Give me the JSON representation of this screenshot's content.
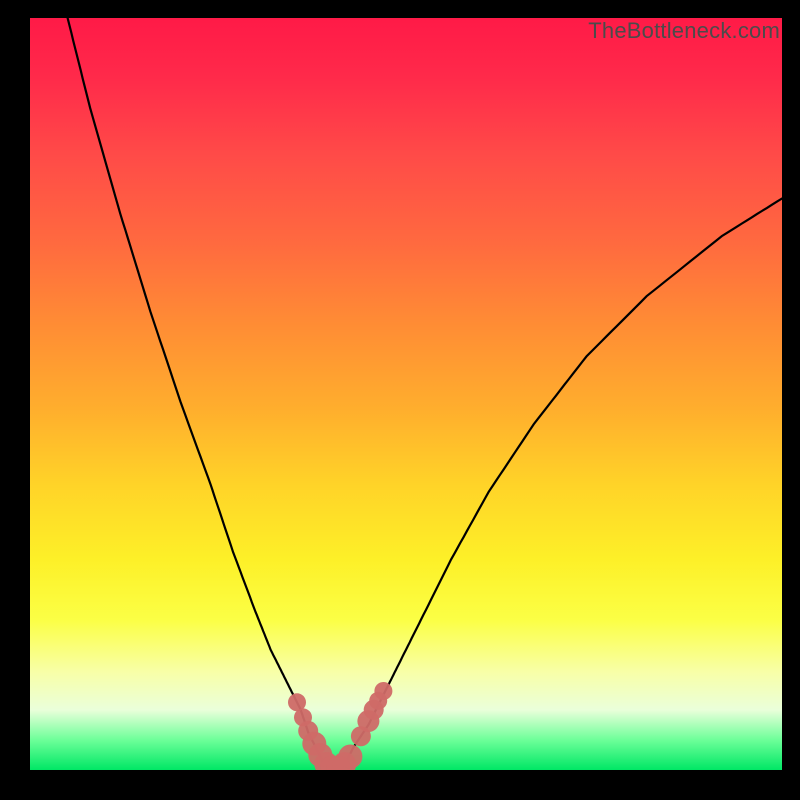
{
  "watermark": "TheBottleneck.com",
  "colors": {
    "background": "#000000",
    "gradient_top": "#ff1a47",
    "gradient_bottom": "#00e765",
    "curve_stroke": "#000000",
    "marker_fill": "#cf6a67"
  },
  "chart_data": {
    "type": "line",
    "title": "",
    "xlabel": "",
    "ylabel": "",
    "xlim": [
      0,
      100
    ],
    "ylim": [
      0,
      100
    ],
    "grid": false,
    "series": [
      {
        "name": "bottleneck_curve",
        "x": [
          5,
          8,
          12,
          16,
          20,
          24,
          27,
          30,
          32,
          34,
          36,
          37,
          38,
          39,
          40,
          41,
          42,
          43,
          45,
          47,
          49,
          52,
          56,
          61,
          67,
          74,
          82,
          92,
          100
        ],
        "values": [
          100,
          88,
          74,
          61,
          49,
          38,
          29,
          21,
          16,
          12,
          8,
          5,
          3,
          1,
          0,
          0,
          1,
          3,
          6,
          10,
          14,
          20,
          28,
          37,
          46,
          55,
          63,
          71,
          76
        ]
      }
    ],
    "markers": {
      "name": "highlight_points",
      "x": [
        35.5,
        36.3,
        37.0,
        37.8,
        38.6,
        39.4,
        40.2,
        41.0,
        41.8,
        42.6,
        44.0,
        45.0,
        45.7,
        46.3,
        47.0
      ],
      "values": [
        9.0,
        7.0,
        5.2,
        3.5,
        2.0,
        0.8,
        0.3,
        0.3,
        0.8,
        1.8,
        4.5,
        6.5,
        8.0,
        9.2,
        10.5
      ],
      "size": [
        9,
        9,
        10,
        12,
        12,
        12,
        12,
        12,
        12,
        12,
        10,
        11,
        10,
        9,
        9
      ]
    }
  }
}
